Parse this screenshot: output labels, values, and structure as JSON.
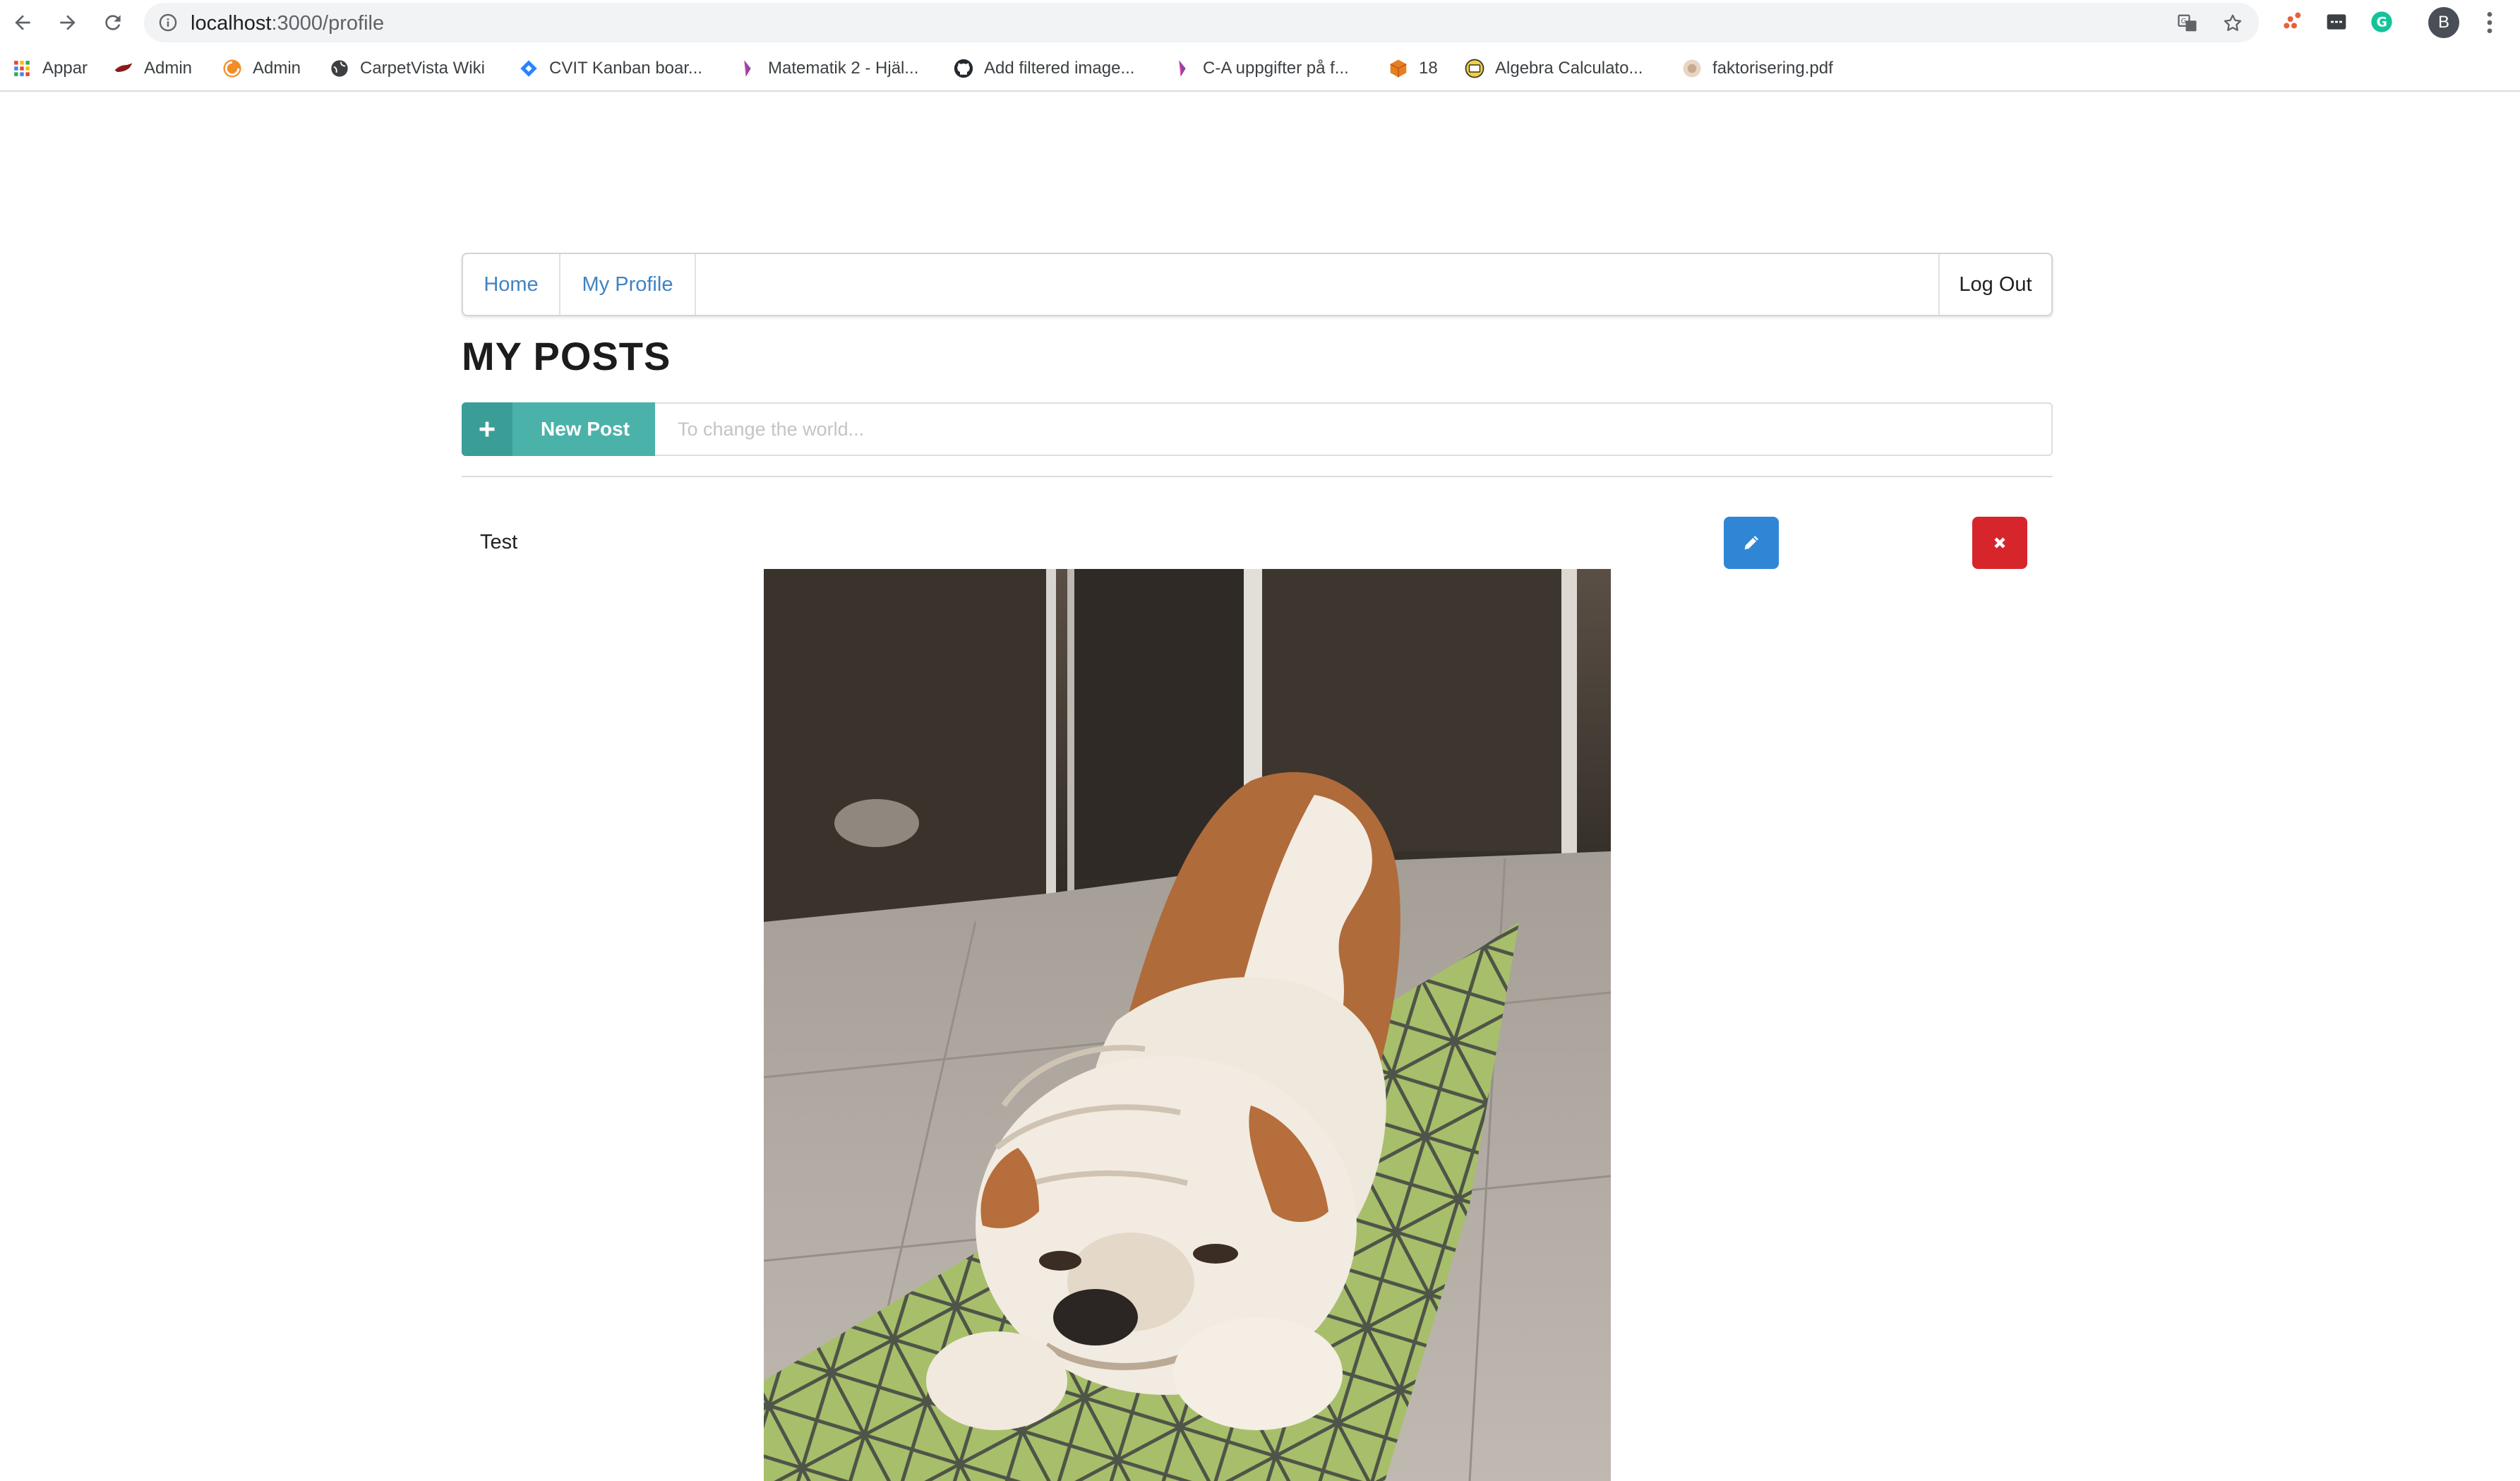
{
  "browser": {
    "url_host": "localhost",
    "url_path": ":3000/profile",
    "profile_initial": "B",
    "icons": [
      "back-arrow-icon",
      "forward-arrow-icon",
      "reload-icon",
      "info-icon",
      "translate-icon",
      "star-icon",
      "menu-dots-icon"
    ],
    "bookmarks": [
      {
        "label": "Appar",
        "icon": "apps-grid-icon"
      },
      {
        "label": "Admin",
        "icon": "bird-icon"
      },
      {
        "label": "Admin",
        "icon": "swirl-icon"
      },
      {
        "label": "CarpetVista Wiki",
        "icon": "globe-icon"
      },
      {
        "label": "CVIT Kanban boar...",
        "icon": "jira-diamond-icon"
      },
      {
        "label": "Matematik 2 - Hjäl...",
        "icon": "pen-icon"
      },
      {
        "label": "Add filtered image...",
        "icon": "github-icon"
      },
      {
        "label": "C-A uppgifter på f...",
        "icon": "pen-icon"
      },
      {
        "label": "18",
        "icon": "cube-icon"
      },
      {
        "label": "Algebra Calculato...",
        "icon": "calculator-icon"
      },
      {
        "label": "faktorisering.pdf",
        "icon": "pdf-icon"
      }
    ]
  },
  "nav": {
    "home": "Home",
    "my_profile": "My Profile",
    "logout": "Log Out"
  },
  "page": {
    "title": "MY POSTS"
  },
  "post_form": {
    "button_label": "New Post",
    "input_placeholder": "To change the world...",
    "input_value": ""
  },
  "posts": [
    {
      "text": "Test",
      "image_alt": "bulldog lying on a green patterned mat"
    }
  ],
  "colors": {
    "link": "#4183c4",
    "teal_button": "#4bb2aa",
    "edit_button": "#2f86d5",
    "delete_button": "#d6262b"
  }
}
